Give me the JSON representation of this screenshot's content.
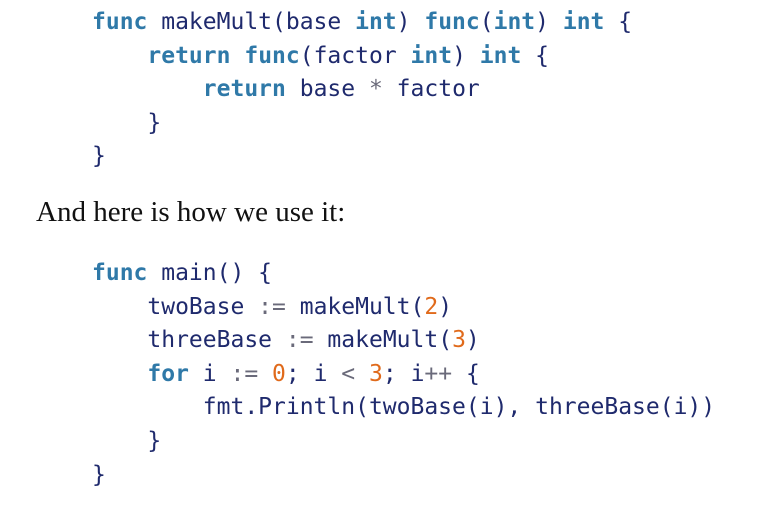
{
  "code_block_1": {
    "lines": [
      [
        {
          "t": "func",
          "k": "kw"
        },
        {
          "t": " makeMult(base ",
          "k": "plain"
        },
        {
          "t": "int",
          "k": "kw"
        },
        {
          "t": ") ",
          "k": "plain"
        },
        {
          "t": "func",
          "k": "kw"
        },
        {
          "t": "(",
          "k": "plain"
        },
        {
          "t": "int",
          "k": "kw"
        },
        {
          "t": ") ",
          "k": "plain"
        },
        {
          "t": "int",
          "k": "kw"
        },
        {
          "t": " {",
          "k": "plain"
        }
      ],
      [
        {
          "t": "    ",
          "k": "plain"
        },
        {
          "t": "return",
          "k": "kw"
        },
        {
          "t": " ",
          "k": "plain"
        },
        {
          "t": "func",
          "k": "kw"
        },
        {
          "t": "(factor ",
          "k": "plain"
        },
        {
          "t": "int",
          "k": "kw"
        },
        {
          "t": ") ",
          "k": "plain"
        },
        {
          "t": "int",
          "k": "kw"
        },
        {
          "t": " {",
          "k": "plain"
        }
      ],
      [
        {
          "t": "        ",
          "k": "plain"
        },
        {
          "t": "return",
          "k": "kw"
        },
        {
          "t": " base ",
          "k": "plain"
        },
        {
          "t": "*",
          "k": "op"
        },
        {
          "t": " factor",
          "k": "plain"
        }
      ],
      [
        {
          "t": "    }",
          "k": "plain"
        }
      ],
      [
        {
          "t": "}",
          "k": "plain"
        }
      ]
    ]
  },
  "prose": {
    "text": "And here is how we use it:"
  },
  "code_block_2": {
    "lines": [
      [
        {
          "t": "func",
          "k": "kw"
        },
        {
          "t": " main() {",
          "k": "plain"
        }
      ],
      [
        {
          "t": "    twoBase ",
          "k": "plain"
        },
        {
          "t": ":=",
          "k": "op"
        },
        {
          "t": " makeMult(",
          "k": "plain"
        },
        {
          "t": "2",
          "k": "num"
        },
        {
          "t": ")",
          "k": "plain"
        }
      ],
      [
        {
          "t": "    threeBase ",
          "k": "plain"
        },
        {
          "t": ":=",
          "k": "op"
        },
        {
          "t": " makeMult(",
          "k": "plain"
        },
        {
          "t": "3",
          "k": "num"
        },
        {
          "t": ")",
          "k": "plain"
        }
      ],
      [
        {
          "t": "    ",
          "k": "plain"
        },
        {
          "t": "for",
          "k": "kw"
        },
        {
          "t": " i ",
          "k": "plain"
        },
        {
          "t": ":=",
          "k": "op"
        },
        {
          "t": " ",
          "k": "plain"
        },
        {
          "t": "0",
          "k": "num"
        },
        {
          "t": "; i ",
          "k": "plain"
        },
        {
          "t": "<",
          "k": "op"
        },
        {
          "t": " ",
          "k": "plain"
        },
        {
          "t": "3",
          "k": "num"
        },
        {
          "t": "; i",
          "k": "plain"
        },
        {
          "t": "++",
          "k": "op"
        },
        {
          "t": " {",
          "k": "plain"
        }
      ],
      [
        {
          "t": "        fmt.Println(twoBase(i), threeBase(i))",
          "k": "plain"
        }
      ],
      [
        {
          "t": "    }",
          "k": "plain"
        }
      ],
      [
        {
          "t": "}",
          "k": "plain"
        }
      ]
    ]
  }
}
